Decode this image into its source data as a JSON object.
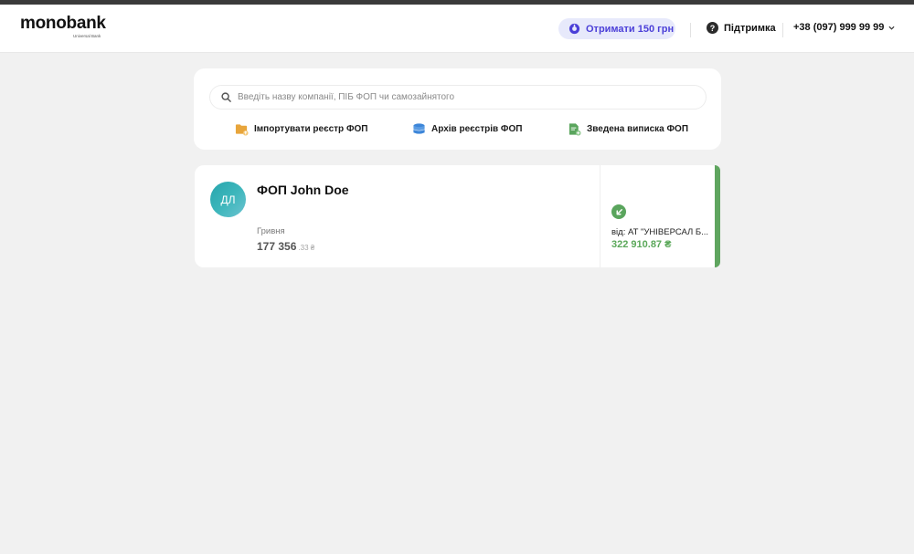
{
  "header": {
    "logo": {
      "name": "monobank",
      "subtitle": "Universal Bank"
    },
    "promo": {
      "label": "Отримати 150 грн",
      "icon": "gift-icon",
      "accent": "#4b3fd8"
    },
    "support": {
      "label": "Підтримка",
      "icon": "chat-question-icon"
    },
    "phone": {
      "label": "+38 (097) 999 99 99",
      "icon": "chevron-down-icon"
    }
  },
  "search": {
    "placeholder": "Введіть назву компанії, ПІБ ФОП чи самозайнятого",
    "icon": "search-icon"
  },
  "actions": [
    {
      "label": "Імпортувати реєстр ФОП",
      "icon": "folder-upload-icon",
      "color": "#e8a53b"
    },
    {
      "label": "Архів реєстрів ФОП",
      "icon": "archive-stack-icon",
      "color": "#3d86d9"
    },
    {
      "label": "Зведена виписка ФОП",
      "icon": "document-add-icon",
      "color": "#5aa55d"
    }
  ],
  "account": {
    "initials": "ДЛ",
    "name": "ФОП John Doe",
    "currency_label": "Гривня",
    "balance_main": "177 356",
    "balance_cents": ".33 ₴",
    "last_transaction": {
      "icon": "incoming-arrow-icon",
      "from": "від: АТ \"УНІВЕРСАЛ Б...",
      "amount": "322 910.87 ₴",
      "color": "#5ba85a"
    }
  }
}
